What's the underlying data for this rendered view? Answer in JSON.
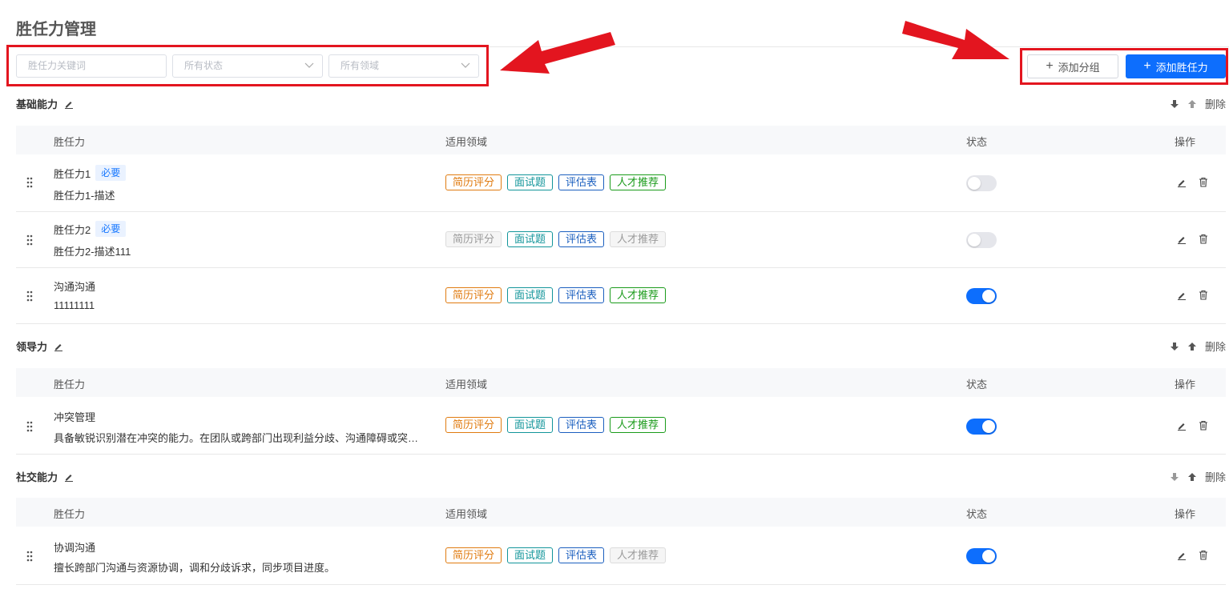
{
  "page": {
    "title": "胜任力管理"
  },
  "filters": {
    "keyword_placeholder": "胜任力关键词",
    "status_placeholder": "所有状态",
    "domain_placeholder": "所有领域"
  },
  "toolbar": {
    "add_group": "添加分组",
    "add_competency": "添加胜任力"
  },
  "columns": {
    "competency": "胜任力",
    "domain": "适用领域",
    "status": "状态",
    "actions": "操作"
  },
  "labels": {
    "required": "必要",
    "delete": "删除"
  },
  "domain_tags": [
    "简历评分",
    "面试题",
    "评估表",
    "人才推荐"
  ],
  "groups": [
    {
      "name": "基础能力",
      "rows": [
        {
          "name": "胜任力1",
          "required": true,
          "desc": "胜任力1-描述",
          "tags_enabled": [
            true,
            true,
            true,
            true
          ],
          "status": "off"
        },
        {
          "name": "胜任力2",
          "required": true,
          "desc": "胜任力2-描述111",
          "tags_enabled": [
            false,
            true,
            true,
            false
          ],
          "status": "off"
        },
        {
          "name": "沟通沟通",
          "required": false,
          "desc": "11111111",
          "tags_enabled": [
            true,
            true,
            true,
            true
          ],
          "status": "on"
        }
      ]
    },
    {
      "name": "领导力",
      "rows": [
        {
          "name": "冲突管理",
          "required": false,
          "desc": "具备敏锐识别潜在冲突的能力。在团队或跨部门出现利益分歧、沟通障碍或突…",
          "tags_enabled": [
            true,
            true,
            true,
            true
          ],
          "status": "on"
        }
      ]
    },
    {
      "name": "社交能力",
      "rows": [
        {
          "name": "协调沟通",
          "required": false,
          "desc": "擅长跨部门沟通与资源协调，调和分歧诉求，同步项目进度。",
          "tags_enabled": [
            true,
            true,
            true,
            false
          ],
          "status": "on"
        }
      ]
    }
  ],
  "colors": {
    "primary": "#0d6efd",
    "annotation": "#e3151f"
  }
}
